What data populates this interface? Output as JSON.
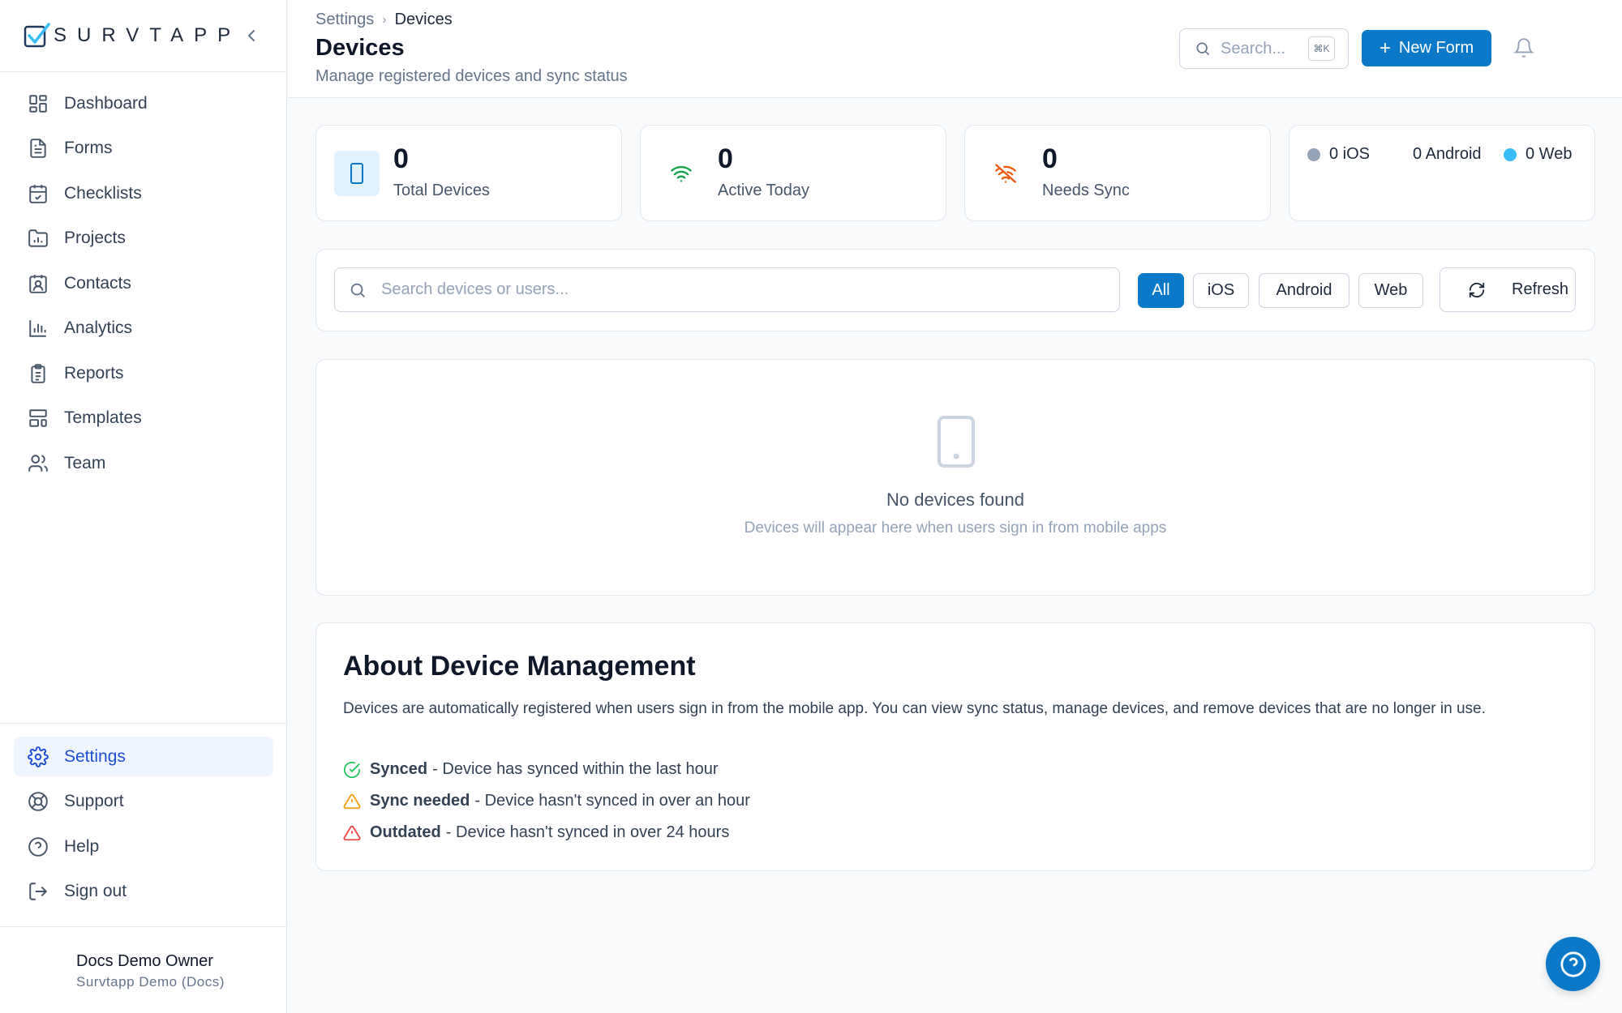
{
  "brand": {
    "name": "SURVTAPP"
  },
  "sidebar": {
    "items": [
      {
        "label": "Dashboard",
        "icon": "dashboard-grid-icon"
      },
      {
        "label": "Forms",
        "icon": "document-icon"
      },
      {
        "label": "Checklists",
        "icon": "calendar-check-icon"
      },
      {
        "label": "Projects",
        "icon": "folder-chart-icon"
      },
      {
        "label": "Contacts",
        "icon": "contact-card-icon"
      },
      {
        "label": "Analytics",
        "icon": "bar-chart-icon"
      },
      {
        "label": "Reports",
        "icon": "clipboard-icon"
      },
      {
        "label": "Templates",
        "icon": "layout-template-icon"
      },
      {
        "label": "Team",
        "icon": "users-icon"
      }
    ],
    "bottom_items": [
      {
        "label": "Settings",
        "icon": "gear-icon",
        "active": true
      },
      {
        "label": "Support",
        "icon": "lifebuoy-icon"
      },
      {
        "label": "Help",
        "icon": "help-circle-icon"
      },
      {
        "label": "Sign out",
        "icon": "sign-out-icon"
      }
    ],
    "user": {
      "name": "Docs Demo Owner",
      "org": "Survtapp Demo (Docs)"
    }
  },
  "header": {
    "breadcrumb": [
      "Settings",
      "Devices"
    ],
    "title": "Devices",
    "subtitle": "Manage registered devices and sync status",
    "search_placeholder": "Search...",
    "shortcut": "⌘K",
    "new_form_label": "New Form"
  },
  "stats": [
    {
      "value": "0",
      "label": "Total Devices",
      "icon": "phone-icon"
    },
    {
      "value": "0",
      "label": "Active Today",
      "icon": "wifi-icon"
    },
    {
      "value": "0",
      "label": "Needs Sync",
      "icon": "wifi-off-icon"
    }
  ],
  "platforms": [
    {
      "label": "0 iOS",
      "color": "#94a3b8"
    },
    {
      "label": "0 Android",
      "color": "#22c55e"
    },
    {
      "label": "0 Web",
      "color": "#38bdf8"
    }
  ],
  "filters": {
    "search_placeholder": "Search devices or users...",
    "chips": [
      "All",
      "iOS",
      "Android",
      "Web"
    ],
    "active_chip": "All",
    "refresh_label": "Refresh"
  },
  "empty_state": {
    "title": "No devices found",
    "subtitle": "Devices will appear here when users sign in from mobile apps"
  },
  "about": {
    "title": "About Device Management",
    "body": "Devices are automatically registered when users sign in from the mobile app. You can view sync status, manage devices, and remove devices that are no longer in use.",
    "statuses": [
      {
        "name": "Synced",
        "desc": "- Device has synced within the last hour",
        "color": "#22c55e",
        "icon": "check-circle-icon"
      },
      {
        "name": "Sync needed",
        "desc": "- Device hasn't synced in over an hour",
        "color": "#f59e0b",
        "icon": "warning-triangle-icon"
      },
      {
        "name": "Outdated",
        "desc": "- Device hasn't synced in over 24 hours",
        "color": "#ef4444",
        "icon": "alert-triangle-icon"
      }
    ]
  },
  "colors": {
    "primary": "#0b79c8",
    "active_nav_bg": "#eff6ff"
  }
}
